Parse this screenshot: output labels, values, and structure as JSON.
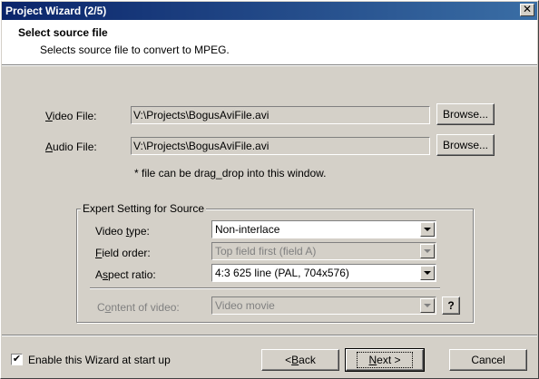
{
  "window": {
    "title": "Project Wizard (2/5)",
    "close_glyph": "✕"
  },
  "header": {
    "title": "Select source file",
    "subtitle": "Selects source file to convert to MPEG."
  },
  "files": {
    "video_label_key": "V",
    "video_label_rest": "ideo File:",
    "video_value": "V:\\Projects\\BogusAviFile.avi",
    "audio_label_key": "A",
    "audio_label_rest": "udio File:",
    "audio_value": "V:\\Projects\\BogusAviFile.avi",
    "browse_label": "Browse...",
    "hint": "* file can be drag_drop into this window."
  },
  "expert": {
    "legend": "Expert Setting for Source",
    "video_type_label_pre": "Video ",
    "video_type_label_key": "t",
    "video_type_label_post": "ype:",
    "video_type_value": "Non-interlace",
    "field_order_label_key": "F",
    "field_order_label_rest": "ield order:",
    "field_order_value": "Top field first (field A)",
    "aspect_label_pre": "A",
    "aspect_label_key": "s",
    "aspect_label_post": "pect ratio:",
    "aspect_value": "4:3 625 line (PAL, 704x576)",
    "content_label_pre": "C",
    "content_label_key": "o",
    "content_label_post": "ntent of video:",
    "content_value": "Video movie",
    "help_label": "?"
  },
  "footer": {
    "enable_label": "Enable this Wizard at start up",
    "enable_checked": true,
    "checkmark": "✔",
    "back_arrow": "< ",
    "back_key": "B",
    "back_rest": "ack",
    "next_key": "N",
    "next_rest": "ext >",
    "cancel_label": "Cancel"
  }
}
